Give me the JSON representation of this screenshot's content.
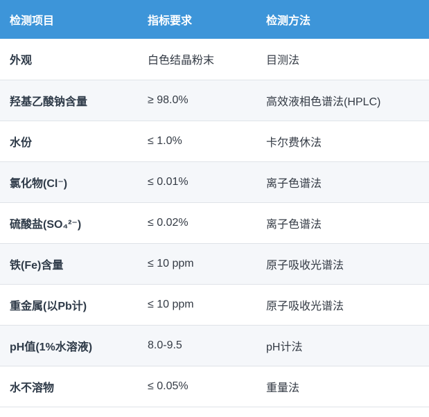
{
  "table": {
    "headers": [
      "检测项目",
      "指标要求",
      "检测方法"
    ],
    "rows": [
      {
        "item": "外观",
        "spec": "白色结晶粉末",
        "method": "目测法"
      },
      {
        "item": "羟基乙酸钠含量",
        "spec": "≥ 98.0%",
        "method": "高效液相色谱法(HPLC)"
      },
      {
        "item": "水份",
        "spec": "≤ 1.0%",
        "method": "卡尔费休法"
      },
      {
        "item": "氯化物(Cl⁻)",
        "spec": "≤ 0.01%",
        "method": "离子色谱法"
      },
      {
        "item": "硫酸盐(SO₄²⁻)",
        "spec": "≤ 0.02%",
        "method": "离子色谱法"
      },
      {
        "item": "铁(Fe)含量",
        "spec": "≤ 10 ppm",
        "method": "原子吸收光谱法"
      },
      {
        "item": "重金属(以Pb计)",
        "spec": "≤ 10 ppm",
        "method": "原子吸收光谱法"
      },
      {
        "item": "pH值(1%水溶液)",
        "spec": "8.0-9.5",
        "method": "pH计法"
      },
      {
        "item": "水不溶物",
        "spec": "≤ 0.05%",
        "method": "重量法"
      }
    ]
  }
}
